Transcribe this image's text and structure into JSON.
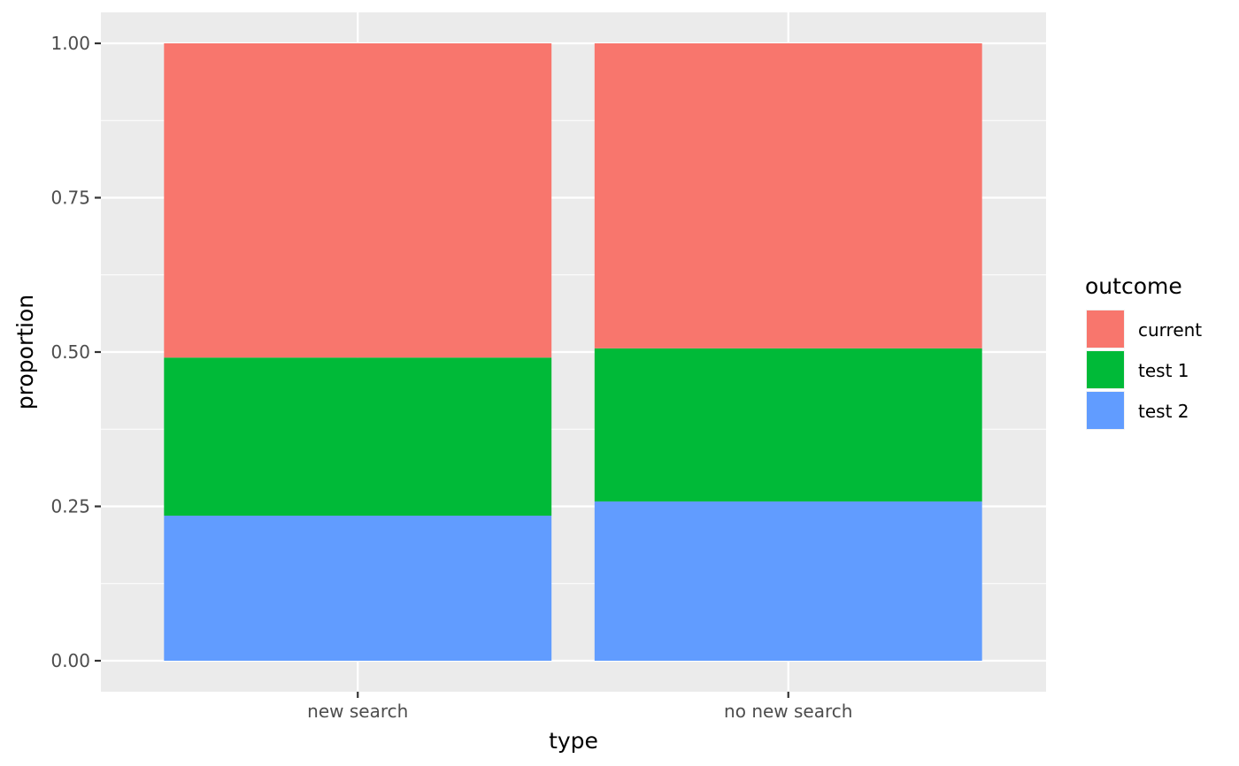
{
  "chart_data": {
    "type": "bar",
    "stacked": true,
    "xlabel": "type",
    "ylabel": "proportion",
    "categories": [
      "new search",
      "no new search"
    ],
    "ylim": [
      0,
      1
    ],
    "yticks": [
      "0.00",
      "0.25",
      "0.50",
      "0.75",
      "1.00"
    ],
    "ytick_values": [
      0,
      0.25,
      0.5,
      0.75,
      1.0
    ],
    "grid": true,
    "legend": {
      "title": "outcome",
      "position": "right"
    },
    "series": [
      {
        "name": "test 2",
        "color": "#619CFF",
        "values": [
          0.235,
          0.258
        ]
      },
      {
        "name": "test 1",
        "color": "#00BA38",
        "values": [
          0.256,
          0.248
        ]
      },
      {
        "name": "current",
        "color": "#F8766D",
        "values": [
          0.509,
          0.494
        ]
      }
    ],
    "legend_order": [
      "current",
      "test 1",
      "test 2"
    ]
  }
}
